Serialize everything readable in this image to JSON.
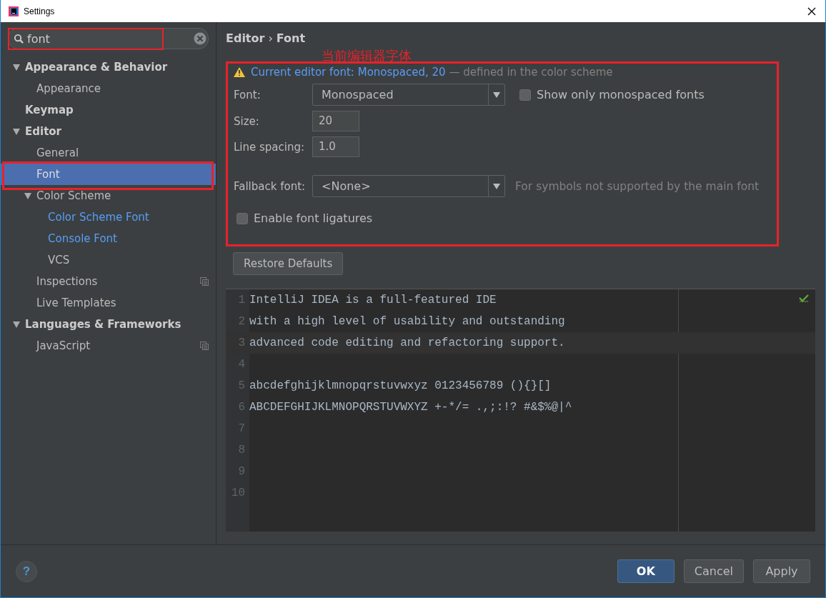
{
  "window": {
    "title": "Settings"
  },
  "search": {
    "value": "font"
  },
  "tree": [
    {
      "label": "Appearance & Behavior",
      "selected": false,
      "expanded": true,
      "highlighted": false,
      "copy_icon": false,
      "children": [
        {
          "label": "Appearance",
          "selected": false,
          "highlighted": false,
          "copy_icon": false
        }
      ]
    },
    {
      "label": "Keymap",
      "selected": false,
      "highlighted": false,
      "copy_icon": false
    },
    {
      "label": "Editor",
      "selected": false,
      "expanded": true,
      "highlighted": false,
      "copy_icon": false,
      "children": [
        {
          "label": "General",
          "selected": false,
          "highlighted": false,
          "copy_icon": false
        },
        {
          "label": "Font",
          "selected": true,
          "highlighted": false,
          "copy_icon": false
        },
        {
          "label": "Color Scheme",
          "selected": false,
          "expanded": true,
          "highlighted": false,
          "copy_icon": false,
          "children": [
            {
              "label": "Color Scheme Font",
              "selected": false,
              "highlighted": true,
              "copy_icon": false
            },
            {
              "label": "Console Font",
              "selected": false,
              "highlighted": true,
              "copy_icon": false
            },
            {
              "label": "VCS",
              "selected": false,
              "highlighted": false,
              "copy_icon": false
            }
          ]
        },
        {
          "label": "Inspections",
          "selected": false,
          "highlighted": false,
          "copy_icon": true
        },
        {
          "label": "Live Templates",
          "selected": false,
          "highlighted": false,
          "copy_icon": false
        }
      ]
    },
    {
      "label": "Languages & Frameworks",
      "selected": false,
      "expanded": true,
      "highlighted": false,
      "copy_icon": false,
      "children": [
        {
          "label": "JavaScript",
          "selected": false,
          "highlighted": false,
          "copy_icon": true
        }
      ]
    }
  ],
  "breadcrumb": [
    "Editor",
    "›",
    "Font"
  ],
  "annotation": "当前编辑器字体",
  "notice": {
    "link": "Current editor font: Monospaced, 20",
    "rest": "— defined in the color scheme"
  },
  "font": {
    "label": "Font:",
    "value": "Monospaced",
    "checkbox": {
      "label": "Show only monospaced fonts",
      "checked": false
    }
  },
  "size": {
    "label": "Size:",
    "value": "20"
  },
  "line_spacing": {
    "label": "Line spacing:",
    "value": "1.0"
  },
  "fallback": {
    "label": "Fallback font:",
    "value": "<None>",
    "hint": "For symbols not supported by the main font"
  },
  "ligatures": {
    "label": "Enable font ligatures",
    "checked": false
  },
  "restore_button": "Restore Defaults",
  "preview_lines": [
    {
      "number": "1",
      "text": "IntelliJ IDEA is a full-featured IDE",
      "current": false
    },
    {
      "number": "2",
      "text": "with a high level of usability and outstanding",
      "current": false
    },
    {
      "number": "3",
      "text": "advanced code editing and refactoring support.",
      "current": true
    },
    {
      "number": "4",
      "current": false
    },
    {
      "number": "5",
      "text": "abcdefghijklmnopqrstuvwxyz 0123456789 (){}[]",
      "current": false
    },
    {
      "number": "6",
      "text": "ABCDEFGHIJKLMNOPQRSTUVWXYZ +-*/= .,;:!? #&$%@|^",
      "current": false
    },
    {
      "number": "7",
      "current": false
    },
    {
      "number": "8",
      "current": false
    },
    {
      "number": "9",
      "current": false
    },
    {
      "number": "10",
      "current": false
    }
  ],
  "help_button": "?",
  "buttons": [
    {
      "label": "OK",
      "default": true
    },
    {
      "label": "Cancel",
      "default": false
    },
    {
      "label": "Apply",
      "default": false
    }
  ]
}
